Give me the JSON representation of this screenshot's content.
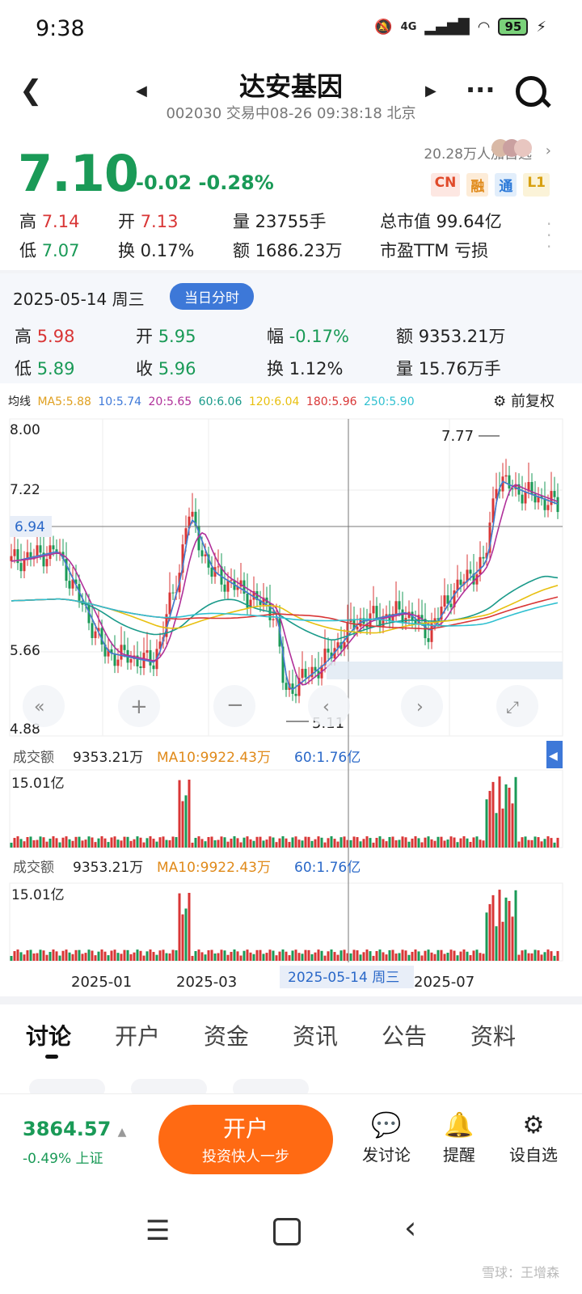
{
  "status": {
    "time": "9:38",
    "network": "4G",
    "battery": "95"
  },
  "header": {
    "title": "达安基因",
    "subtitle": "002030 交易中08-26 09:38:18 北京"
  },
  "quote": {
    "price": "7.10",
    "change": "-0.02",
    "change_pct": "-0.28%",
    "followers": "20.28万人加自选",
    "badges": [
      "CN",
      "融",
      "通",
      "L1"
    ],
    "stats": {
      "high_label": "高",
      "high": "7.14",
      "open_label": "开",
      "open": "7.13",
      "vol": "量 23755手",
      "mcap": "总市值 99.64亿",
      "low_label": "低",
      "low": "7.07",
      "turnover": "换 0.17%",
      "amount": "额 1686.23万",
      "pe": "市盈TTM 亏损"
    }
  },
  "day": {
    "date": "2025-05-14 周三",
    "btn": "当日分时",
    "high_label": "高",
    "high": "5.98",
    "open_label": "开",
    "open": "5.95",
    "amp_label": "幅",
    "amp": "-0.17%",
    "amt_label": "额",
    "amt": "9353.21万",
    "low_label": "低",
    "low": "5.89",
    "close_label": "收",
    "close": "5.96",
    "turn_label": "换",
    "turn": "1.12%",
    "vol_label": "量",
    "vol": "15.76万手"
  },
  "ma": {
    "label": "均线",
    "items": [
      "MA5:5.88",
      "10:5.74",
      "20:5.65",
      "60:6.06",
      "120:6.04",
      "180:5.96",
      "250:5.90"
    ],
    "colors": [
      "#e0a020",
      "#3d78d8",
      "#b0309a",
      "#1a9a8a",
      "#e8c010",
      "#d93636",
      "#30c0d0"
    ],
    "adjust": "前复权"
  },
  "chart_data": {
    "type": "candlestick",
    "y_ticks": [
      "8.00",
      "7.22",
      "6.94",
      "5.66",
      "4.88"
    ],
    "crosshair_value": "6.94",
    "max_label": "7.77",
    "min_label": "5.11",
    "x_ticks": [
      "2025-01",
      "2025-03",
      "2025-05-14 周三",
      "2025-07"
    ],
    "volume_panels": [
      {
        "label": "成交额",
        "value": "9353.21万",
        "ma10": "MA10:9922.43万",
        "ma60": "60:1.76亿",
        "max": "15.01亿"
      },
      {
        "label": "成交额",
        "value": "9353.21万",
        "ma10": "MA10:9922.43万",
        "ma60": "60:1.76亿",
        "max": "15.01亿"
      }
    ]
  },
  "tabs": [
    "讨论",
    "开户",
    "资金",
    "资讯",
    "公告",
    "资料"
  ],
  "bottom": {
    "index_value": "3864.57",
    "index_sub": "-0.49% 上证",
    "kaihu": "开户",
    "kaihu_sub": "投资快人一步",
    "actions": [
      "发讨论",
      "提醒",
      "设自选"
    ]
  },
  "watermark": "雪球：王增森"
}
